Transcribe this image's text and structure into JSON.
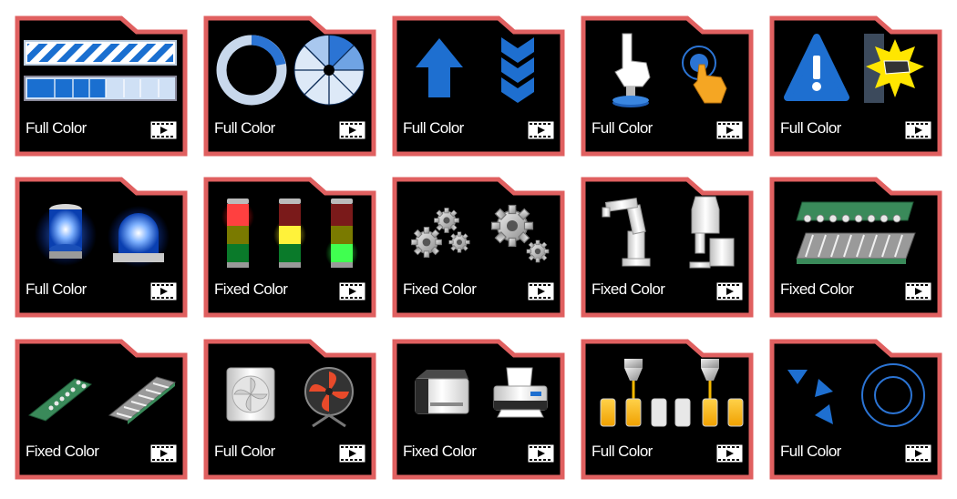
{
  "colors": {
    "frame": "#e06060",
    "background": "#000000",
    "label": "#ffffff"
  },
  "cards": [
    {
      "label": "Full Color",
      "icons": [
        "striped-progress-bar-icon",
        "segmented-progress-bar-icon"
      ]
    },
    {
      "label": "Full Color",
      "icons": [
        "ring-progress-icon",
        "pie-segments-icon"
      ]
    },
    {
      "label": "Full Color",
      "icons": [
        "up-arrow-icon",
        "down-chevrons-icon"
      ]
    },
    {
      "label": "Full Color",
      "icons": [
        "hand-press-button-icon",
        "finger-tap-icon"
      ]
    },
    {
      "label": "Full Color",
      "icons": [
        "warning-exclamation-icon",
        "hand-danger-icon"
      ]
    },
    {
      "label": "Full Color",
      "icons": [
        "blue-cylinder-lamp-icon",
        "blue-dome-beacon-icon"
      ]
    },
    {
      "label": "Fixed Color",
      "icons": [
        "signal-tower-red-icon",
        "signal-tower-yellow-icon",
        "signal-tower-green-icon"
      ]
    },
    {
      "label": "Fixed Color",
      "icons": [
        "gear-cluster-icon",
        "gear-pair-icon"
      ]
    },
    {
      "label": "Fixed Color",
      "icons": [
        "robot-arm-icon",
        "robot-cell-icon"
      ]
    },
    {
      "label": "Fixed Color",
      "icons": [
        "roller-conveyor-icon",
        "flat-conveyor-icon"
      ]
    },
    {
      "label": "Fixed Color",
      "icons": [
        "diagonal-belt-conveyor-icon",
        "diagonal-roller-conveyor-icon"
      ]
    },
    {
      "label": "Full Color",
      "icons": [
        "ventilation-fan-icon",
        "standing-fan-icon"
      ]
    },
    {
      "label": "Fixed Color",
      "icons": [
        "desktop-printer-icon",
        "inkjet-printer-icon"
      ]
    },
    {
      "label": "Full Color",
      "icons": [
        "filling-nozzle-icon",
        "filling-bottles-icon"
      ]
    },
    {
      "label": "Full Color",
      "icons": [
        "rotating-triangles-icon",
        "concentric-circle-icon"
      ]
    }
  ]
}
